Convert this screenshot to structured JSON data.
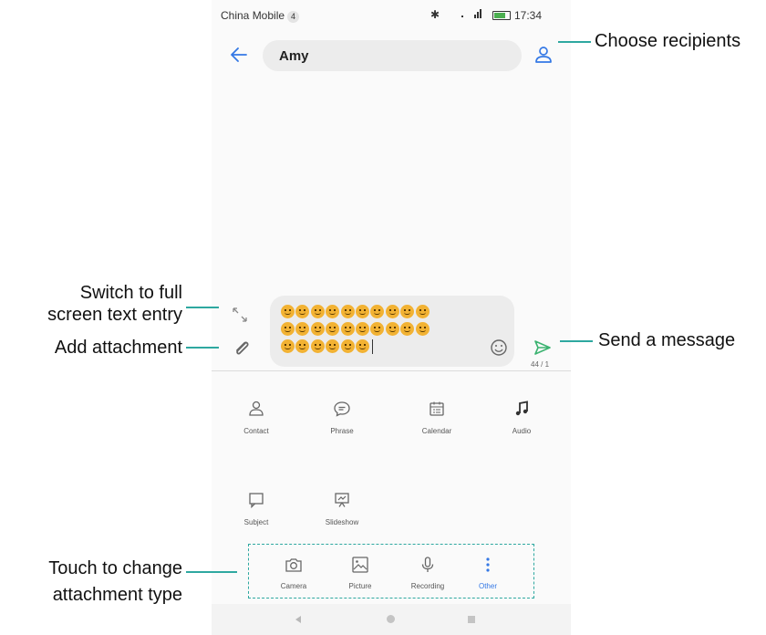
{
  "status_bar": {
    "carrier": "China Mobile",
    "badge": "4",
    "time": "17:34"
  },
  "header": {
    "recipient": "Amy"
  },
  "compose": {
    "counter": "44 / 1",
    "emoji_rows": [
      10,
      10,
      6
    ]
  },
  "attachments": {
    "row1": [
      {
        "label": "Contact",
        "icon": "person-icon"
      },
      {
        "label": "Phrase",
        "icon": "chat-bubble-icon"
      },
      {
        "label": "Calendar",
        "icon": "calendar-icon"
      },
      {
        "label": "Audio",
        "icon": "music-note-icon"
      }
    ],
    "row2": [
      {
        "label": "Subject",
        "icon": "subject-icon"
      },
      {
        "label": "Slideshow",
        "icon": "slideshow-icon"
      }
    ]
  },
  "attachment_types": [
    {
      "label": "Camera",
      "icon": "camera-icon"
    },
    {
      "label": "Picture",
      "icon": "picture-icon"
    },
    {
      "label": "Recording",
      "icon": "microphone-icon"
    },
    {
      "label": "Other",
      "icon": "more-vertical-icon"
    }
  ],
  "callouts": {
    "choose_recipients": "Choose recipients",
    "switch_fullscreen_1": "Switch to full",
    "switch_fullscreen_2": "screen text entry",
    "add_attachment": "Add attachment",
    "send_message": "Send a message",
    "touch_change_1": "Touch to change",
    "touch_change_2": "attachment type"
  },
  "colors": {
    "accent": "#3478e5",
    "callout_line": "#2ea8a0",
    "send": "#3cb371"
  }
}
